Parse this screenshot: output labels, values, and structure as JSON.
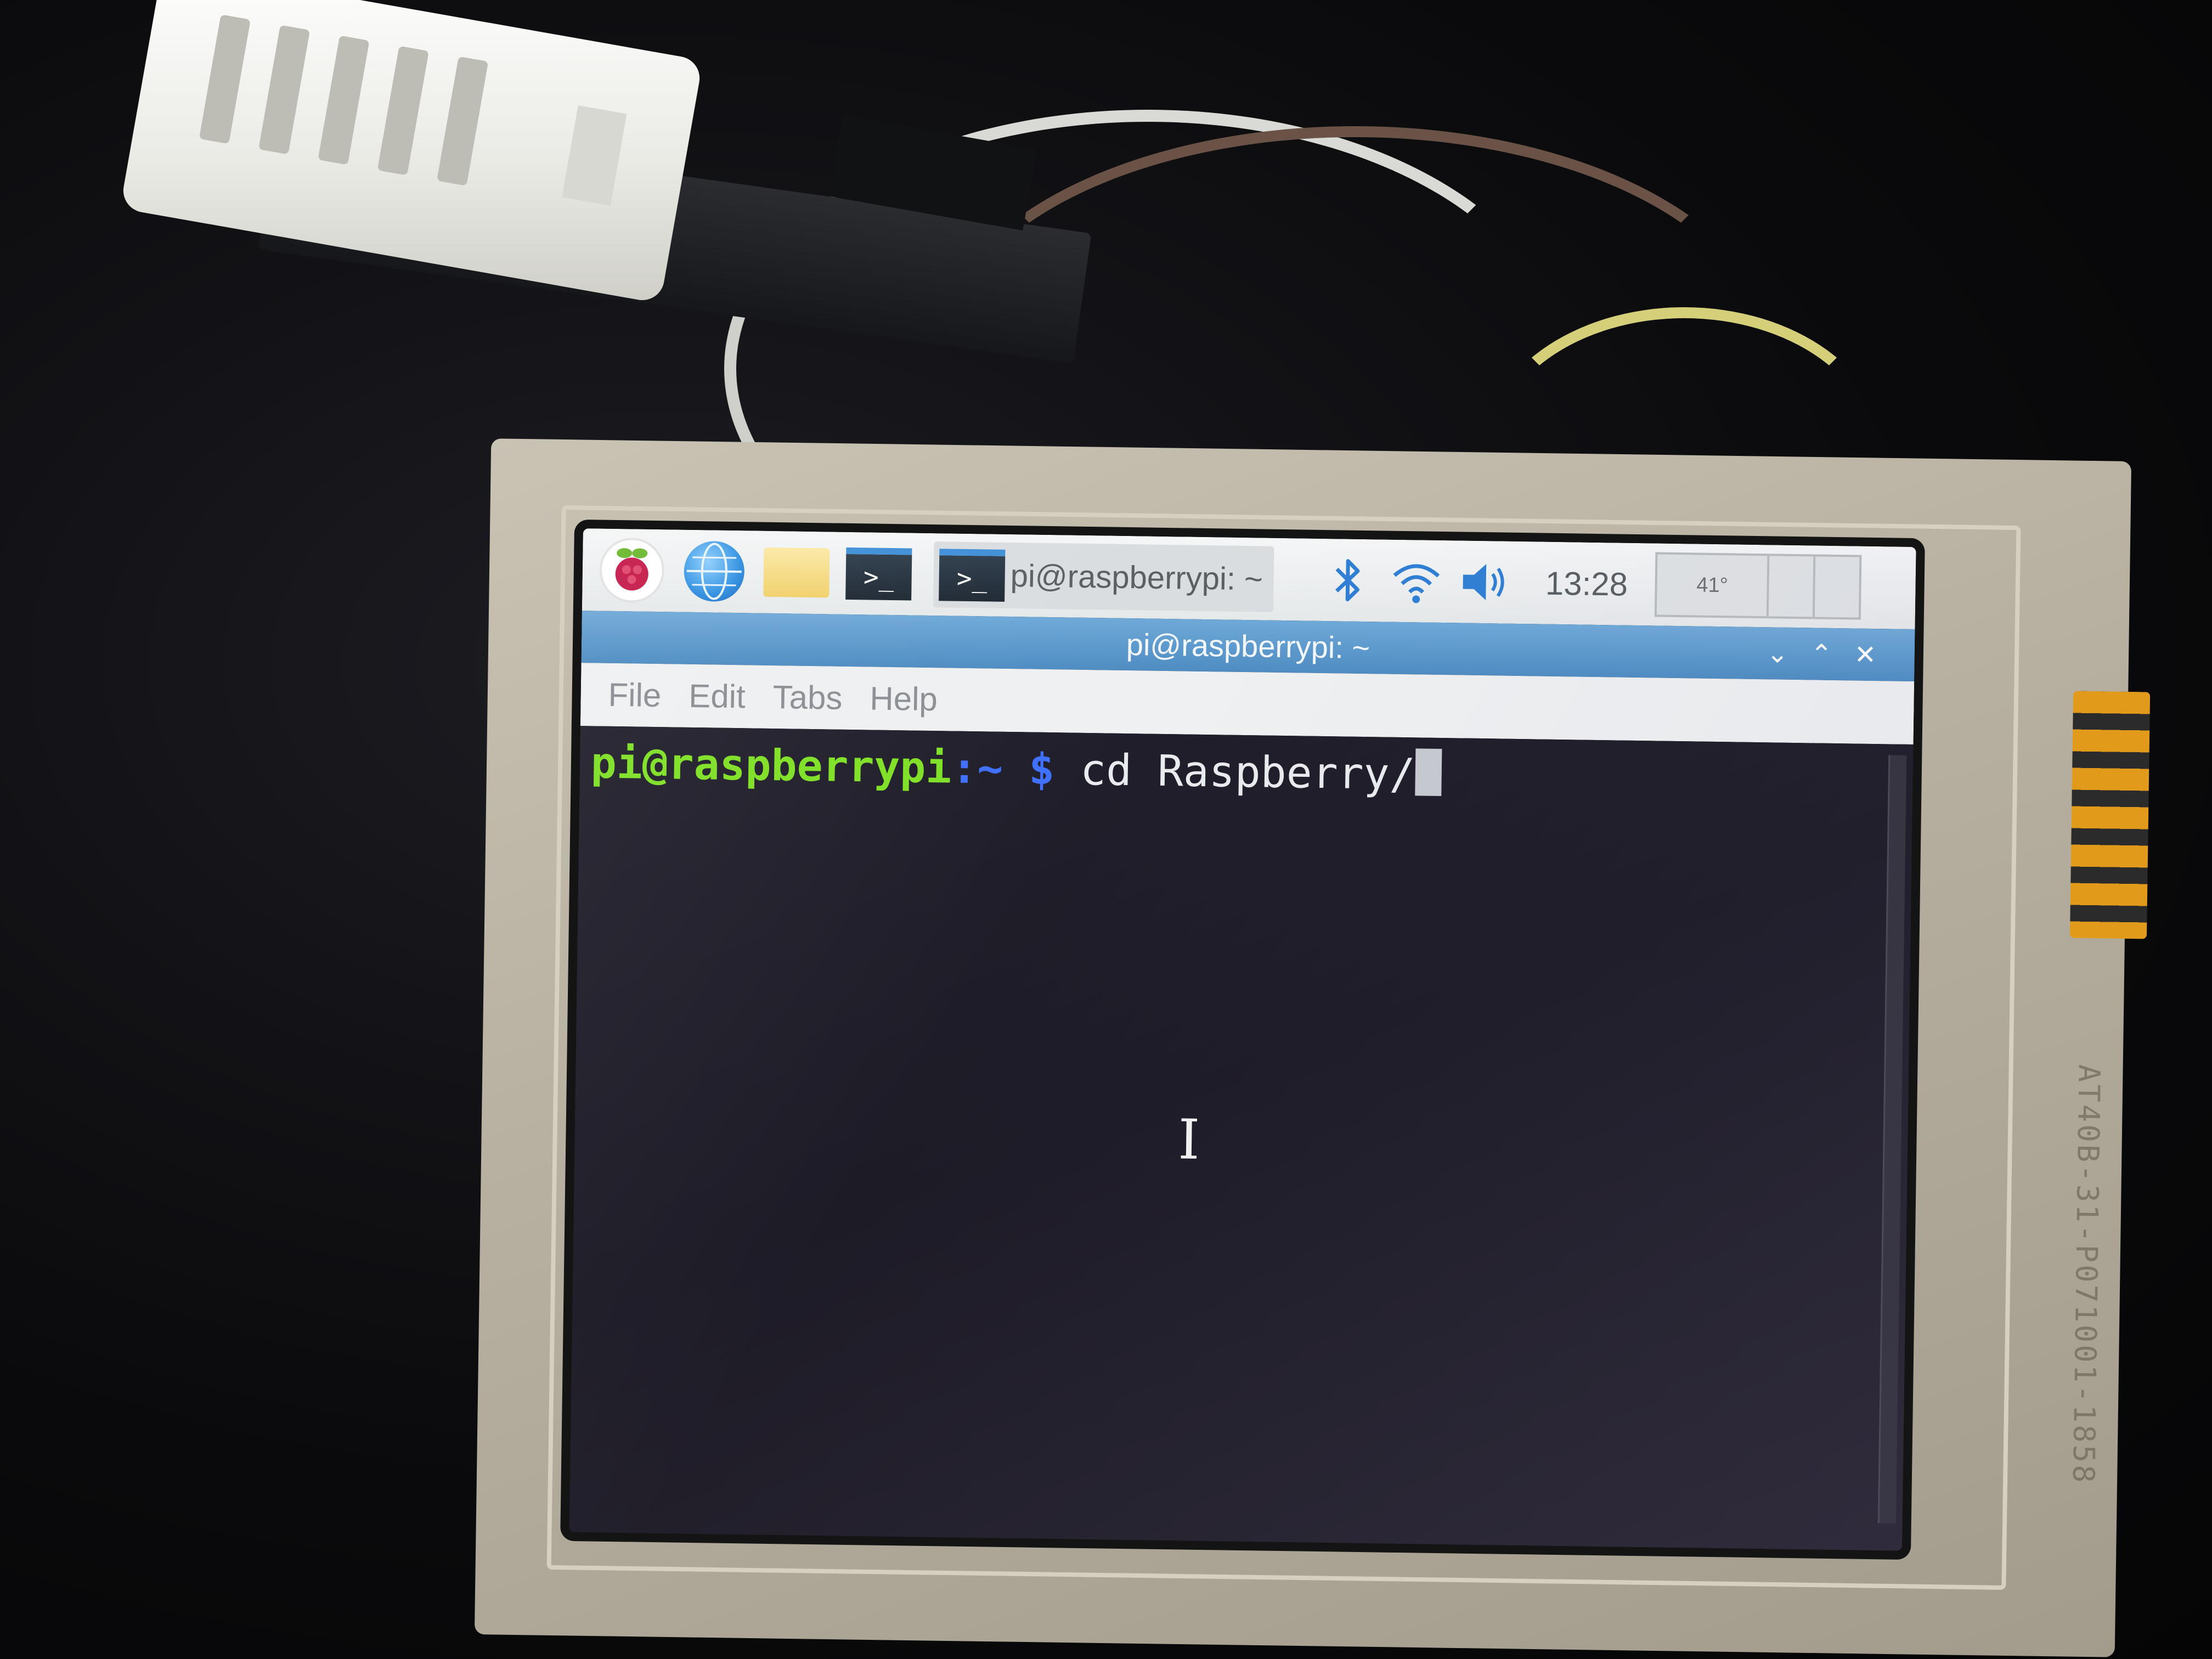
{
  "taskbar": {
    "launchers": [
      {
        "icon": "raspberry-pi-menu-icon"
      },
      {
        "icon": "web-browser-icon"
      },
      {
        "icon": "file-manager-icon"
      },
      {
        "icon": "terminal-icon",
        "glyph": ">_"
      }
    ],
    "active_task": {
      "icon": "terminal-icon",
      "glyph": ">_",
      "label": "pi@raspberrypi: ~"
    },
    "tray": {
      "icons": [
        "bluetooth-icon",
        "wifi-icon",
        "volume-icon"
      ],
      "clock": "13:28",
      "cpu_temp": "41°"
    }
  },
  "window": {
    "title": "pi@raspberrypi: ~",
    "controls": {
      "minimize": "⌄",
      "maximize": "⌃",
      "close": "✕"
    }
  },
  "menubar": {
    "items": [
      "File",
      "Edit",
      "Tabs",
      "Help"
    ]
  },
  "terminal": {
    "prompt_user": "pi@raspberrypi",
    "prompt_sep": ":",
    "prompt_path": "~ $",
    "command": " cd Raspberry/"
  },
  "device": {
    "side_print": "AT40B-31-P071001-1858"
  },
  "colors": {
    "prompt_user": "#7fe026",
    "prompt_path": "#3f6fff",
    "titlebar": "#5a98cc",
    "terminal_bg": "#1f1d28"
  }
}
